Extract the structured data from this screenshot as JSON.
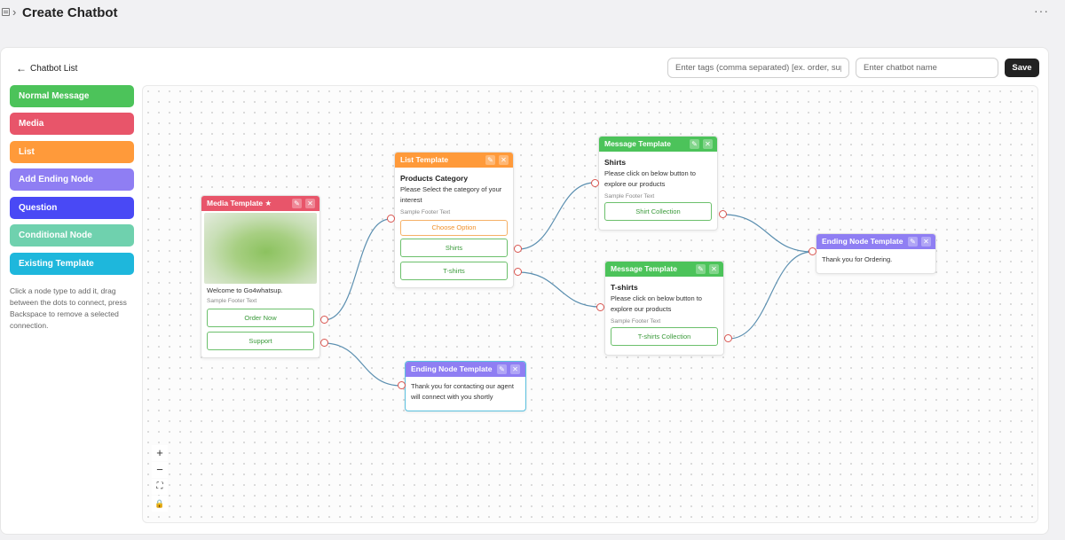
{
  "header": {
    "title": "Create Chatbot",
    "breadcrumb_sep": "›",
    "more": "···"
  },
  "back_link": {
    "arrow": "←",
    "label": "Chatbot List"
  },
  "tags_input": {
    "placeholder": "Enter tags (comma separated) [ex. order, support]",
    "value": ""
  },
  "name_input": {
    "placeholder": "Enter chatbot name",
    "value": ""
  },
  "save_label": "Save",
  "palette": [
    {
      "label": "Normal Message",
      "color": "#4cc35a"
    },
    {
      "label": "Media",
      "color": "#e8556a"
    },
    {
      "label": "List",
      "color": "#ff9a3a"
    },
    {
      "label": "Add Ending Node",
      "color": "#8f7ef3"
    },
    {
      "label": "Question",
      "color": "#4949f5"
    },
    {
      "label": "Conditional Node",
      "color": "#6fd1ae"
    },
    {
      "label": "Existing Template",
      "color": "#1eb7dc"
    }
  ],
  "help_text": "Click a node type to add it, drag between the dots to connect, press Backspace to remove a selected connection.",
  "icons": {
    "edit": "✎",
    "close": "✕"
  },
  "nodes": {
    "media": {
      "header": "Media Template ★",
      "color": "#e8556a",
      "text": "Welcome to Go4whatsup.",
      "footer": "Sample Footer Text",
      "buttons": [
        "Order Now",
        "Support"
      ]
    },
    "list": {
      "header": "List Template",
      "color": "#ff9a3a",
      "title": "Products Category",
      "text": "Please Select the category of your interest",
      "footer": "Sample Footer Text",
      "choose": "Choose Option",
      "buttons": [
        "Shirts",
        "T-shirts"
      ]
    },
    "msg1": {
      "header": "Message Template",
      "color": "#4cc35a",
      "title": "Shirts",
      "text": "Please click on below button to explore our products",
      "footer": "Sample Footer Text",
      "buttons": [
        "Shirt Collection"
      ]
    },
    "msg2": {
      "header": "Message Template",
      "color": "#4cc35a",
      "title": "T-shirts",
      "text": "Please click on below button to explore our products",
      "footer": "Sample Footer Text",
      "buttons": [
        "T-shirts Collection"
      ]
    },
    "end1": {
      "header": "Ending Node Template",
      "color": "#8f7ef3",
      "text": "Thank you for contacting our agent will connect with you shortly"
    },
    "end2": {
      "header": "Ending Node Template",
      "color": "#8f7ef3",
      "text": "Thank you for Ordering."
    }
  },
  "zoom_controls": {
    "zoom_in": "+",
    "zoom_out": "−",
    "fit": "⛶",
    "lock": "🔒"
  },
  "edge_color": "#5b8fb0"
}
